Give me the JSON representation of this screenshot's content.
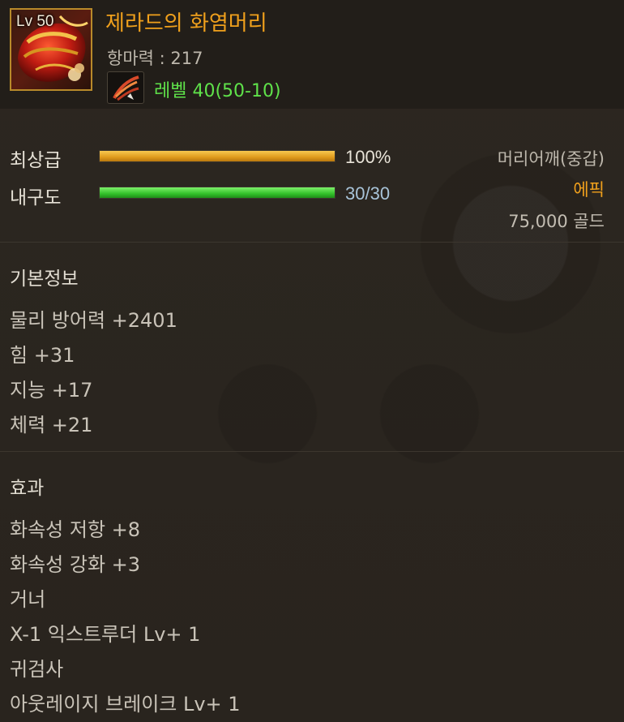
{
  "item": {
    "level_badge": "Lv 50",
    "name": "제라드의 화염머리",
    "resistance": "항마력 : 217",
    "level_requirement": "레벨 40(50-10)",
    "icon": "fire-helmet-icon",
    "skill_icon": "wing-feather-icon"
  },
  "bars": {
    "grade_label": "최상급",
    "grade_percent": 100,
    "grade_value": "100%",
    "durability_label": "내구도",
    "durability_current": 30,
    "durability_max": 30,
    "durability_value": "30/30"
  },
  "info": {
    "slot": "머리어깨(중갑)",
    "rarity": "에픽",
    "price": "75,000 골드"
  },
  "basic": {
    "title": "기본정보",
    "stats": [
      "물리 방어력 +2401",
      "힘 +31",
      "지능 +17",
      "체력 +21"
    ]
  },
  "effects": {
    "title": "효과",
    "lines": [
      "화속성 저항 +8",
      "화속성 강화 +3",
      "거너",
      "X-1 익스트루더 Lv+ 1",
      "귀검사",
      "아웃레이지 브레이크 Lv+ 1"
    ]
  },
  "colors": {
    "item_name": "#f0a01c",
    "level_req": "#5fe24a",
    "rarity": "#f0a01c",
    "durability_value": "#a8c3d8"
  }
}
